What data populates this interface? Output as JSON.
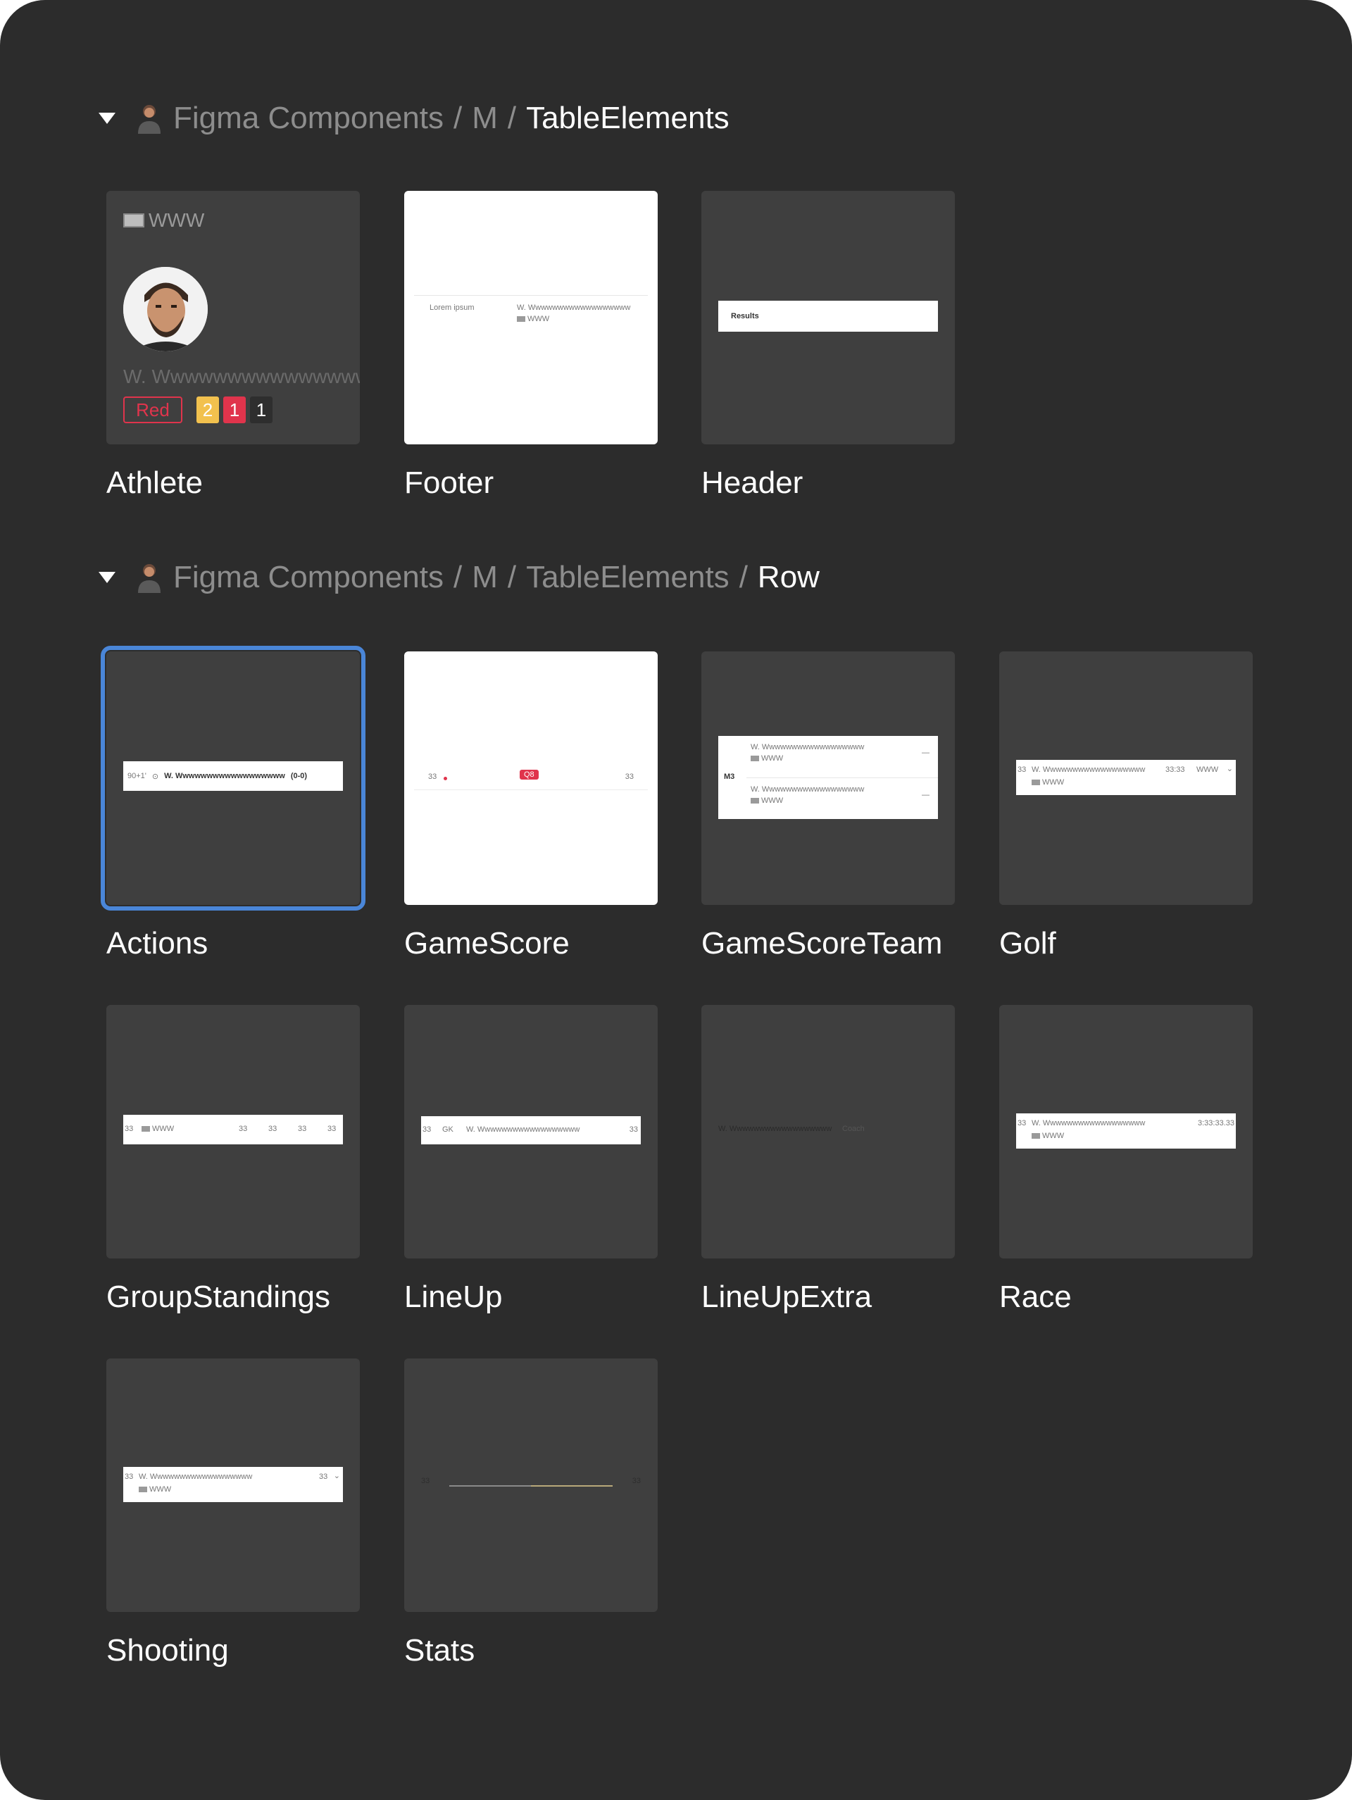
{
  "sections": [
    {
      "crumbs": [
        "Figma Components",
        "M"
      ],
      "current": "TableElements",
      "separator": "/",
      "cards": [
        "Athlete",
        "Footer",
        "Header"
      ]
    },
    {
      "crumbs": [
        "Figma Components",
        "M",
        "TableElements"
      ],
      "current": "Row",
      "separator": "/",
      "cards": [
        "Actions",
        "GameScore",
        "GameScoreTeam",
        "Golf",
        "GroupStandings",
        "LineUp",
        "LineUpExtra",
        "Race",
        "Shooting",
        "Stats"
      ]
    }
  ],
  "thumbs": {
    "athlete": {
      "country": "WWW",
      "name": "W. Wwwwwwwwwwwwwww",
      "card_label": "Red",
      "badge_yellow": "2",
      "badge_red": "1",
      "badge_plain": "1"
    },
    "footer": {
      "left": "Lorem ipsum",
      "name": "W. Wwwwwwwwwwwwwwwwww",
      "country": "WWW"
    },
    "header": {
      "text": "Results"
    },
    "actions": {
      "time": "90+1'",
      "name": "W. Wwwwwwwwwwwwwwwwww",
      "score": "(0-0)"
    },
    "gamescore": {
      "left": "33",
      "badge": "Q8",
      "right": "33"
    },
    "gamescoreteam": {
      "label": "M3",
      "name1": "W. Wwwwwwwwwwwwwwwwww",
      "country1": "WWW",
      "name2": "W. Wwwwwwwwwwwwwwwwww",
      "country2": "WWW",
      "dash": "—"
    },
    "golf": {
      "rank": "33",
      "name": "W. Wwwwwwwwwwwwwwwwww",
      "time": "33:33",
      "country_right": "WWW",
      "country": "WWW"
    },
    "groupstandings": {
      "rank": "33",
      "country": "WWW",
      "v1": "33",
      "v2": "33",
      "v3": "33",
      "v4": "33"
    },
    "lineup": {
      "num": "33",
      "pos": "GK",
      "name": "W. Wwwwwwwwwwwwwwwwww",
      "right": "33"
    },
    "lineupextra": {
      "name": "W. Wwwwwwwwwwwwwwwwww",
      "role": "Coach"
    },
    "race": {
      "rank": "33",
      "name": "W. Wwwwwwwwwwwwwwwwww",
      "time": "3:33:33.33",
      "country": "WWW"
    },
    "shooting": {
      "rank": "33",
      "name": "W. Wwwwwwwwwwwwwwwwww",
      "value": "33",
      "country": "WWW"
    },
    "stats": {
      "left": "33",
      "right": "33"
    }
  },
  "colors": {
    "background": "#2c2c2c",
    "thumb_bg": "#3f3f3f",
    "selection": "#4a86d8",
    "red": "#e0344c",
    "yellow": "#f2c14e"
  }
}
